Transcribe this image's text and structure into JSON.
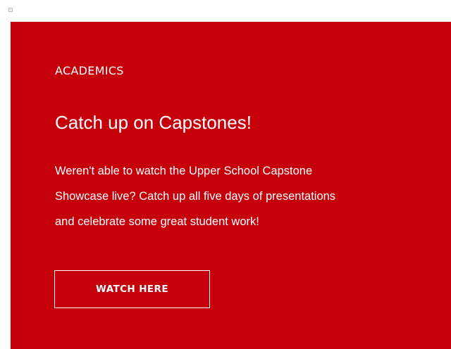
{
  "card": {
    "eyebrow": "ACADEMICS",
    "headline": "Catch up on Capstones!",
    "body_lines": [
      "Weren't able to watch the Upper School Capstone",
      "Showcase live? Catch up all five days of presentations",
      "and celebrate some great student work!"
    ],
    "cta_label": "WATCH HERE",
    "background_color": "#c6000b",
    "text_color": "#ffffff"
  },
  "broken_image_icon": "broken-image-icon"
}
